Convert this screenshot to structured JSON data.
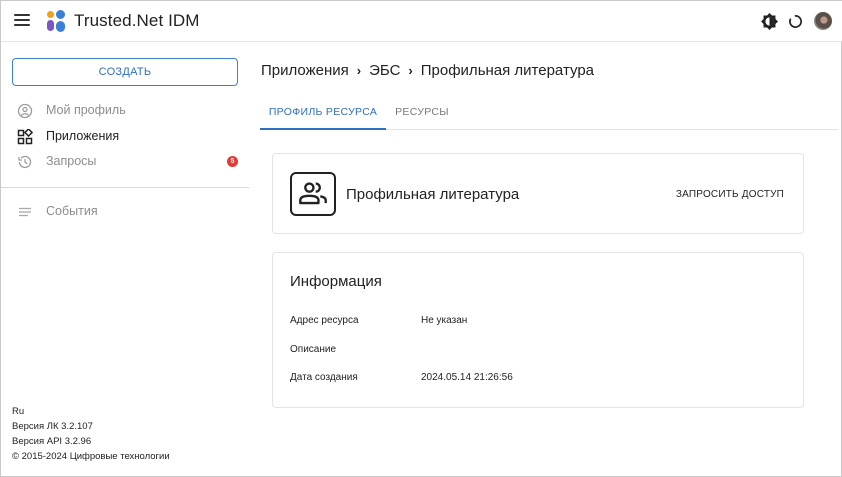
{
  "app": {
    "title": "Trusted.Net IDM",
    "icons": {
      "menu": "menu-icon",
      "logo": "trusted-logo-icon",
      "theme": "theme-toggle-icon",
      "loader": "loading-spinner-icon",
      "avatar": "user-avatar"
    }
  },
  "sidebar": {
    "create_label": "СОЗДАТЬ",
    "items": [
      {
        "label": "Мой профиль",
        "icon": "account-circle-icon",
        "state": "dim"
      },
      {
        "label": "Приложения",
        "icon": "apps-icon",
        "state": "active"
      },
      {
        "label": "Запросы",
        "icon": "history-icon",
        "state": "dim",
        "badge": "5"
      },
      {
        "label": "События",
        "icon": "list-icon",
        "state": "dim"
      }
    ],
    "footer": {
      "language": "Ru",
      "lk_version": "Версия ЛК 3.2.107",
      "api_version": "Версия API 3.2.96",
      "copyright": "© 2015-2024 Цифровые технологии"
    }
  },
  "breadcrumb": [
    "Приложения",
    "ЭБС",
    "Профильная литература"
  ],
  "tabs": [
    {
      "label": "ПРОФИЛЬ РЕСУРСА",
      "active": true
    },
    {
      "label": "РЕСУРСЫ",
      "active": false
    }
  ],
  "resource": {
    "name": "Профильная литература",
    "icon": "group-icon",
    "request_access_label": "ЗАПРОСИТЬ ДОСТУП"
  },
  "info": {
    "title": "Информация",
    "rows": [
      {
        "key": "Адрес ресурса",
        "value": "Не указан"
      },
      {
        "key": "Описание",
        "value": ""
      },
      {
        "key": "Дата создания",
        "value": "2024.05.14 21:26:56"
      }
    ]
  },
  "colors": {
    "accent": "#2f6fc2",
    "badge": "#e53935",
    "divider": "#e4e4e4"
  }
}
